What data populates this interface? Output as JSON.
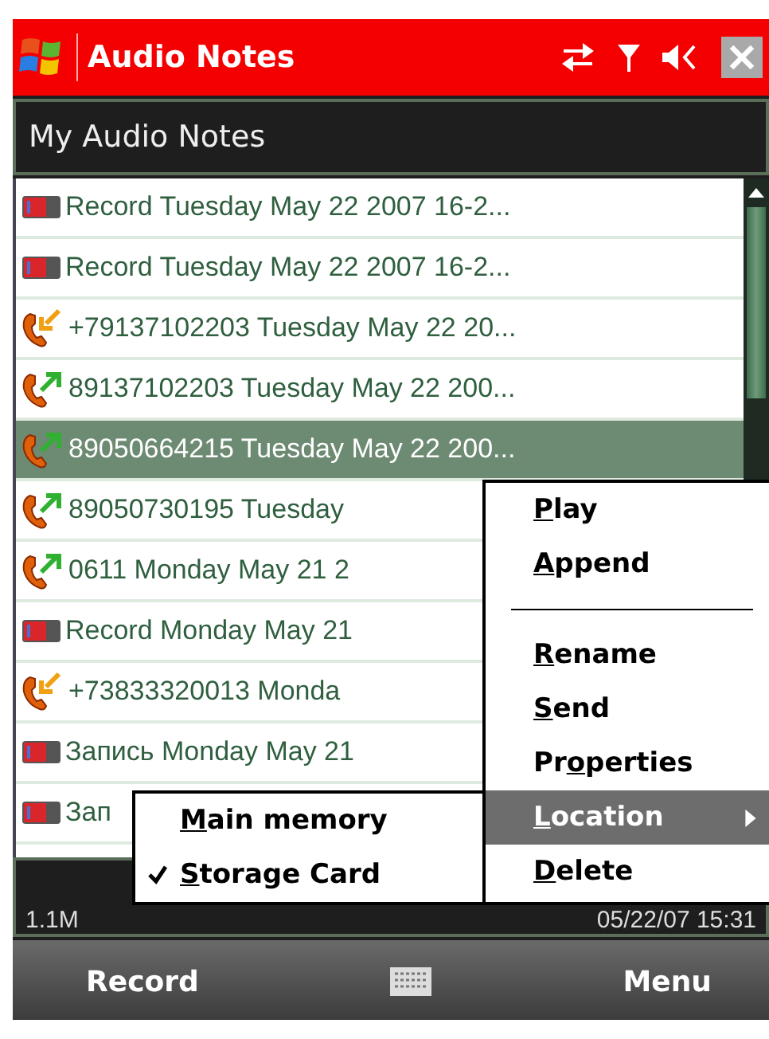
{
  "title_bar": {
    "title": "Audio Notes"
  },
  "header": {
    "title": "My Audio Notes"
  },
  "notes": [
    {
      "kind": "record",
      "label": "Record Tuesday May 22 2007 16-2...",
      "selected": false
    },
    {
      "kind": "record",
      "label": "Record Tuesday May 22 2007 16-2...",
      "selected": false
    },
    {
      "kind": "call_in",
      "label": "+79137102203 Tuesday May 22 20...",
      "selected": false
    },
    {
      "kind": "call_out",
      "label": "89137102203 Tuesday May 22 200...",
      "selected": false
    },
    {
      "kind": "call_out",
      "label": "89050664215 Tuesday May 22 200...",
      "selected": true
    },
    {
      "kind": "call_out",
      "label": "89050730195 Tuesday",
      "selected": false
    },
    {
      "kind": "call_out",
      "label": "0611 Monday May 21 2",
      "selected": false
    },
    {
      "kind": "record",
      "label": "Record Monday May 21",
      "selected": false
    },
    {
      "kind": "call_in",
      "label": "+73833320013 Monda",
      "selected": false
    },
    {
      "kind": "record",
      "label": "Запись Monday May 21",
      "selected": false
    },
    {
      "kind": "record",
      "label": "Зап",
      "selected": false
    }
  ],
  "status_bar": {
    "size": "1.1M",
    "date": "05/22/07 15:31"
  },
  "context_menu": [
    {
      "kind": "item",
      "mnemonic": "P",
      "label_rest": "lay",
      "selected": false
    },
    {
      "kind": "item",
      "mnemonic": "A",
      "label_rest": "ppend",
      "selected": false
    },
    {
      "kind": "separator"
    },
    {
      "kind": "item",
      "mnemonic": "R",
      "label_rest": "ename",
      "selected": false
    },
    {
      "kind": "item",
      "mnemonic": "S",
      "label_rest": "end",
      "selected": false
    },
    {
      "kind": "item",
      "label_start": "Pr",
      "mnemonic": "o",
      "label_rest": "perties",
      "selected": false
    },
    {
      "kind": "submenu",
      "mnemonic": "L",
      "label_rest": "ocation",
      "selected": true
    },
    {
      "kind": "item",
      "mnemonic": "D",
      "label_rest": "elete",
      "selected": false
    }
  ],
  "location_submenu": [
    {
      "mnemonic": "M",
      "label_rest": "ain memory",
      "checked": false
    },
    {
      "mnemonic": "S",
      "label_rest": "torage Card",
      "checked": true
    }
  ],
  "soft_keys": {
    "left": "Record",
    "right": "Menu"
  }
}
